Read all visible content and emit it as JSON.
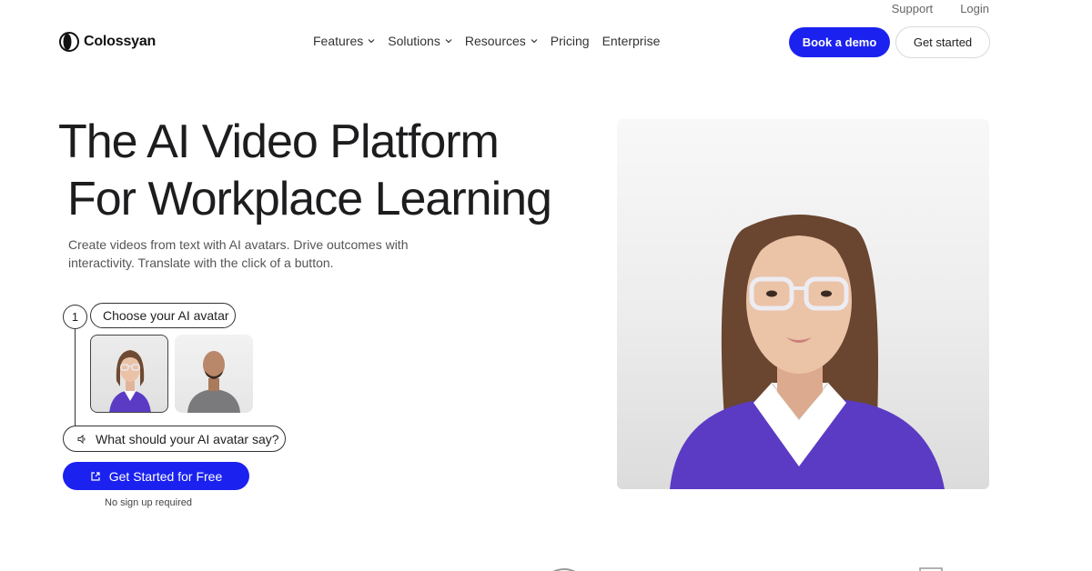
{
  "utility": {
    "support": "Support",
    "login": "Login"
  },
  "brand": {
    "name": "Colossyan"
  },
  "nav": {
    "items": [
      {
        "label": "Features",
        "dropdown": true
      },
      {
        "label": "Solutions",
        "dropdown": true
      },
      {
        "label": "Resources",
        "dropdown": true
      },
      {
        "label": "Pricing",
        "dropdown": false
      },
      {
        "label": "Enterprise",
        "dropdown": false
      }
    ],
    "book_demo": "Book a demo",
    "get_started": "Get started"
  },
  "hero": {
    "title_line1": "The AI Video Platform",
    "title_line2": "For Workplace Learning",
    "subtitle": "Create videos from text with AI avatars. Drive outcomes with interactivity. Translate with the click of a button."
  },
  "steps": {
    "step_number": "1",
    "choose_label": "Choose your AI avatar",
    "say_placeholder": "What should your AI avatar say?",
    "cta": "Get Started for Free",
    "note": "No sign up required"
  },
  "colors": {
    "accent": "#1b22ef",
    "avatar_sweater": "#5b3bc4"
  }
}
